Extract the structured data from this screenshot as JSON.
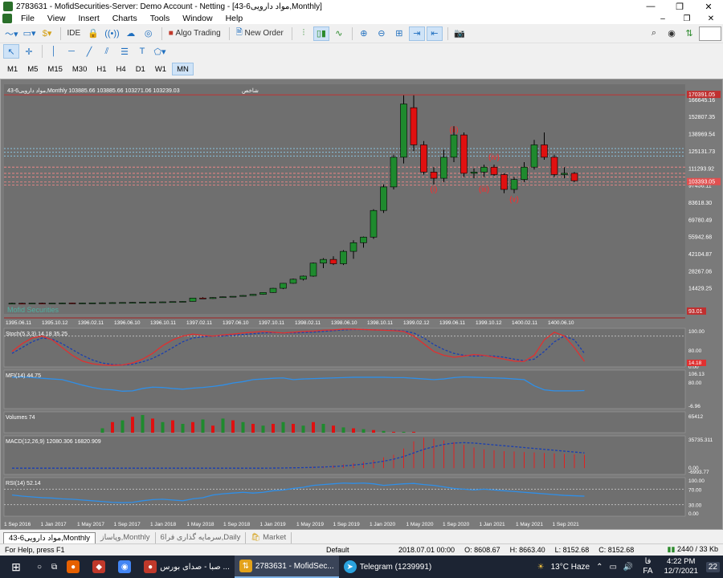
{
  "window": {
    "title": "2783631 - MofidSecurities-Server: Demo Account - Netting - [43-6مواد دارویی,Monthly]",
    "min": "—",
    "max": "❐",
    "close": "✕"
  },
  "menu": {
    "items": [
      "File",
      "View",
      "Insert",
      "Charts",
      "Tools",
      "Window",
      "Help"
    ],
    "right": [
      "–",
      "❐",
      "✕"
    ]
  },
  "toolbar": {
    "ide_label": "IDE",
    "algo_label": "Algo Trading",
    "new_order_label": "New Order"
  },
  "timeframes": [
    "M1",
    "M5",
    "M15",
    "M30",
    "H1",
    "H4",
    "D1",
    "W1",
    "MN"
  ],
  "timeframe_selected": "MN",
  "chart_header": "43-6مواد دارویی,Monthly  103885.66 103885.66 103271.06 103239.03",
  "chart_header_right": "شاخص",
  "watermark": "Mofid Securities",
  "waves": [
    "(i)",
    "(ii)",
    "(iii)",
    "(iv)",
    "(v)"
  ],
  "price_axis": [
    "166645.16",
    "152807.35",
    "138969.54",
    "125131.73",
    "111293.92",
    "97456.11",
    "83618.30",
    "69780.49",
    "55942.68",
    "42104.87",
    "28267.06",
    "14429.25"
  ],
  "price_current": "103393.05",
  "price_top_tag": "170391.05",
  "price_bottom_tag": "93.01",
  "shamsi_dates": [
    "1395.06.11",
    "1395.10.12",
    "1396.02.11",
    "1396.06.10",
    "1396.10.11",
    "1397.02.11",
    "1397.06.10",
    "1397.10.11",
    "1398.02.11",
    "1398.06.10",
    "1398.10.11",
    "1399.02.12",
    "1399.06.11",
    "1399.10.12",
    "1400.02.11",
    "1400.06.10"
  ],
  "date_axis": [
    "1 Sep 2016",
    "1 Jan 2017",
    "1 May 2017",
    "1 Sep 2017",
    "1 Jan 2018",
    "1 May 2018",
    "1 Sep 2018",
    "1 Jan 2019",
    "1 May 2019",
    "1 Sep 2019",
    "1 Jan 2020",
    "1 May 2020",
    "1 Sep 2020",
    "1 Jan 2021",
    "1 May 2021",
    "1 Sep 2021"
  ],
  "indicators": {
    "stoch": {
      "label": "Stoch(5,3,3) 14.18 35.25",
      "axis": [
        "100.00",
        "80.00",
        "0.00"
      ],
      "tag": "14.18"
    },
    "mfi": {
      "label": "MFI(14) 44.75",
      "axis": [
        "106.13",
        "80.00",
        "-6.96"
      ]
    },
    "volumes": {
      "label": "Volumes 74",
      "axis": [
        "65412"
      ]
    },
    "macd": {
      "label": "MACD(12,26,9) 12080.306 16820.909",
      "axis": [
        "35735.311",
        "0.00",
        "-6993.77"
      ]
    },
    "rsi": {
      "label": "RSI(14) 52.14",
      "axis": [
        "100.00",
        "70.00",
        "30.00",
        "0.00"
      ]
    }
  },
  "tabs": [
    "43-6مواد دارویی,Monthly",
    "وپاساز,Monthly",
    "سرمایه گذاری فرا6,Daily",
    "Market"
  ],
  "status": {
    "help": "For Help, press F1",
    "profile": "Default",
    "datetime": "2018.07.01 00:00",
    "open": "O: 8608.67",
    "high": "H: 8663.40",
    "low": "L: 8152.68",
    "close": "C: 8152.68",
    "traffic": "2440 / 33 Kb"
  },
  "taskbar": {
    "items": [
      {
        "label": "صبا - صدای بورس ..."
      },
      {
        "label": "2783631 - MofidSec..."
      },
      {
        "label": "Telegram (1239991)"
      }
    ],
    "weather": "13°C  Haze",
    "lang": "FA",
    "lang_top": "فا",
    "time": "4:22 PM",
    "date": "12/7/2021",
    "notif": "22"
  },
  "chart_data": {
    "type": "candlestick",
    "candles": [
      {
        "o": 2000,
        "h": 2500,
        "l": 1800,
        "c": 2100
      },
      {
        "o": 2100,
        "h": 2400,
        "l": 1900,
        "c": 2000
      },
      {
        "o": 2000,
        "h": 2300,
        "l": 1900,
        "c": 2200
      },
      {
        "o": 2200,
        "h": 2500,
        "l": 2000,
        "c": 2100
      },
      {
        "o": 2100,
        "h": 2300,
        "l": 2000,
        "c": 2200
      },
      {
        "o": 2200,
        "h": 2500,
        "l": 2100,
        "c": 2300
      },
      {
        "o": 2300,
        "h": 2600,
        "l": 2200,
        "c": 2200
      },
      {
        "o": 2200,
        "h": 2400,
        "l": 2100,
        "c": 2300
      },
      {
        "o": 2300,
        "h": 2500,
        "l": 2200,
        "c": 2400
      },
      {
        "o": 2400,
        "h": 2700,
        "l": 2300,
        "c": 2500
      },
      {
        "o": 2500,
        "h": 2800,
        "l": 2400,
        "c": 2600
      },
      {
        "o": 2600,
        "h": 2900,
        "l": 2500,
        "c": 2700
      },
      {
        "o": 2700,
        "h": 3000,
        "l": 2600,
        "c": 2800
      },
      {
        "o": 2800,
        "h": 3100,
        "l": 2700,
        "c": 3000
      },
      {
        "o": 3000,
        "h": 3200,
        "l": 2800,
        "c": 3100
      },
      {
        "o": 3100,
        "h": 3300,
        "l": 3000,
        "c": 3200
      },
      {
        "o": 3200,
        "h": 3500,
        "l": 3100,
        "c": 3400
      },
      {
        "o": 3400,
        "h": 3700,
        "l": 3300,
        "c": 3600
      },
      {
        "o": 3600,
        "h": 6500,
        "l": 3500,
        "c": 6300
      },
      {
        "o": 6300,
        "h": 7000,
        "l": 5800,
        "c": 5900
      },
      {
        "o": 5900,
        "h": 7000,
        "l": 5700,
        "c": 6700
      },
      {
        "o": 6700,
        "h": 7500,
        "l": 6500,
        "c": 7300
      },
      {
        "o": 7300,
        "h": 7800,
        "l": 7000,
        "c": 7700
      },
      {
        "o": 7700,
        "h": 8600,
        "l": 7500,
        "c": 8400
      },
      {
        "o": 8400,
        "h": 9500,
        "l": 8200,
        "c": 9300
      },
      {
        "o": 9300,
        "h": 11000,
        "l": 9000,
        "c": 10800
      },
      {
        "o": 10800,
        "h": 14500,
        "l": 10500,
        "c": 14200
      },
      {
        "o": 14200,
        "h": 18500,
        "l": 13500,
        "c": 18200
      },
      {
        "o": 18200,
        "h": 22000,
        "l": 17800,
        "c": 21500
      },
      {
        "o": 21500,
        "h": 24500,
        "l": 20500,
        "c": 24000
      },
      {
        "o": 24000,
        "h": 35000,
        "l": 23500,
        "c": 34500
      },
      {
        "o": 34500,
        "h": 38500,
        "l": 30500,
        "c": 37500
      },
      {
        "o": 37500,
        "h": 40000,
        "l": 33000,
        "c": 34000
      },
      {
        "o": 34000,
        "h": 45000,
        "l": 33000,
        "c": 44000
      },
      {
        "o": 44000,
        "h": 53000,
        "l": 38000,
        "c": 51000
      },
      {
        "o": 51000,
        "h": 56000,
        "l": 47000,
        "c": 55500
      },
      {
        "o": 55500,
        "h": 78000,
        "l": 54000,
        "c": 77000
      },
      {
        "o": 77000,
        "h": 98000,
        "l": 75000,
        "c": 96000
      },
      {
        "o": 96000,
        "h": 122000,
        "l": 94000,
        "c": 120000
      },
      {
        "o": 120000,
        "h": 170000,
        "l": 115000,
        "c": 163000
      },
      {
        "o": 160000,
        "h": 170000,
        "l": 125000,
        "c": 130000
      },
      {
        "o": 130000,
        "h": 133000,
        "l": 106000,
        "c": 108000
      },
      {
        "o": 108000,
        "h": 112000,
        "l": 98000,
        "c": 103000
      },
      {
        "o": 103000,
        "h": 126000,
        "l": 100000,
        "c": 120000
      },
      {
        "o": 120000,
        "h": 145000,
        "l": 116000,
        "c": 138000
      },
      {
        "o": 138000,
        "h": 140000,
        "l": 104000,
        "c": 107000
      },
      {
        "o": 107000,
        "h": 111000,
        "l": 103000,
        "c": 108000
      },
      {
        "o": 108000,
        "h": 114000,
        "l": 104000,
        "c": 112000
      },
      {
        "o": 112000,
        "h": 114000,
        "l": 105000,
        "c": 106000
      },
      {
        "o": 106000,
        "h": 107000,
        "l": 91000,
        "c": 94000
      },
      {
        "o": 94000,
        "h": 104000,
        "l": 91000,
        "c": 102000
      },
      {
        "o": 102000,
        "h": 116000,
        "l": 100000,
        "c": 112000
      },
      {
        "o": 112000,
        "h": 134000,
        "l": 110000,
        "c": 130000
      },
      {
        "o": 130000,
        "h": 140000,
        "l": 118000,
        "c": 120000
      },
      {
        "o": 120000,
        "h": 122000,
        "l": 104000,
        "c": 106000
      },
      {
        "o": 106000,
        "h": 112000,
        "l": 103000,
        "c": 107000
      },
      {
        "o": 107000,
        "h": 108000,
        "l": 100000,
        "c": 101000
      }
    ],
    "stoch_main": [
      40,
      60,
      75,
      80,
      70,
      50,
      30,
      15,
      8,
      5,
      4,
      5,
      10,
      20,
      35,
      55,
      70,
      80,
      85,
      82,
      80,
      83,
      85,
      88,
      90,
      92,
      90,
      88,
      90,
      92,
      93,
      95,
      96,
      98,
      98,
      97,
      96,
      95,
      94,
      92,
      80,
      60,
      40,
      30,
      25,
      28,
      32,
      30,
      25,
      20,
      15,
      14,
      30,
      70,
      90,
      80,
      50,
      14
    ],
    "stoch_signal": [
      35,
      50,
      65,
      75,
      72,
      60,
      45,
      30,
      18,
      10,
      6,
      5,
      7,
      13,
      22,
      35,
      50,
      65,
      75,
      78,
      80,
      80,
      82,
      84,
      86,
      88,
      89,
      88,
      88,
      89,
      90,
      92,
      94,
      96,
      97,
      97,
      96,
      95,
      95,
      93,
      88,
      75,
      58,
      45,
      35,
      30,
      28,
      29,
      28,
      25,
      20,
      16,
      20,
      40,
      65,
      80,
      70,
      35
    ],
    "mfi": [
      85,
      86,
      84,
      82,
      80,
      78,
      70,
      62,
      55,
      50,
      48,
      44,
      45,
      52,
      56,
      55,
      52,
      50,
      53,
      55,
      58,
      62,
      68,
      72,
      78,
      80,
      82,
      83,
      78,
      80,
      81,
      82,
      83,
      84,
      85,
      85,
      85,
      85,
      84,
      84,
      82,
      80,
      78,
      80,
      84,
      86,
      85,
      84,
      83,
      82,
      80,
      78,
      60,
      48,
      45,
      45,
      45,
      46
    ],
    "volumes": [
      0,
      0,
      0,
      0,
      0,
      0,
      0,
      0,
      0,
      5,
      12,
      14,
      18,
      20,
      16,
      12,
      14,
      10,
      12,
      15,
      8,
      16,
      14,
      12,
      10,
      8,
      10,
      12,
      10,
      8,
      12,
      10,
      8,
      6,
      5,
      4,
      3,
      2,
      1,
      1,
      1,
      0,
      0,
      0,
      0,
      0,
      0,
      0,
      0,
      0,
      0,
      0,
      0,
      0,
      0,
      0,
      0,
      0
    ],
    "macd_hist": [
      0,
      0,
      0,
      0,
      0,
      0,
      0,
      0,
      0,
      0,
      0,
      0,
      0,
      0,
      0,
      0,
      0,
      0,
      0,
      0,
      0,
      0,
      0,
      0,
      0,
      0,
      200,
      400,
      700,
      1000,
      1500,
      2200,
      3000,
      4200,
      5500,
      7000,
      9000,
      12000,
      15000,
      22000,
      30000,
      34000,
      33000,
      31000,
      29000,
      26000,
      23000,
      21000,
      20000,
      19000,
      18500,
      18000,
      17500,
      17000,
      16500,
      16000,
      15500,
      15000
    ],
    "macd_signal": [
      0,
      0,
      0,
      0,
      0,
      0,
      0,
      0,
      0,
      0,
      0,
      0,
      0,
      0,
      0,
      0,
      0,
      0,
      0,
      0,
      0,
      0,
      0,
      0,
      0,
      0,
      100,
      200,
      400,
      600,
      900,
      1300,
      1800,
      2500,
      3400,
      4600,
      6000,
      7800,
      10000,
      13000,
      17000,
      21000,
      24000,
      26500,
      28000,
      28500,
      28000,
      27000,
      26000,
      25000,
      24000,
      23000,
      22000,
      21000,
      20000,
      19000,
      18000,
      17000
    ],
    "rsi": [
      55,
      52,
      50,
      48,
      47,
      45,
      44,
      42,
      40,
      38,
      36,
      35,
      36,
      40,
      43,
      44,
      42,
      40,
      45,
      48,
      55,
      58,
      60,
      62,
      60,
      62,
      66,
      68,
      72,
      75,
      80,
      82,
      84,
      86,
      85,
      86,
      84,
      80,
      82,
      84,
      85,
      82,
      80,
      76,
      72,
      70,
      68,
      70,
      68,
      66,
      64,
      62,
      60,
      58,
      56,
      54,
      53,
      52
    ]
  }
}
